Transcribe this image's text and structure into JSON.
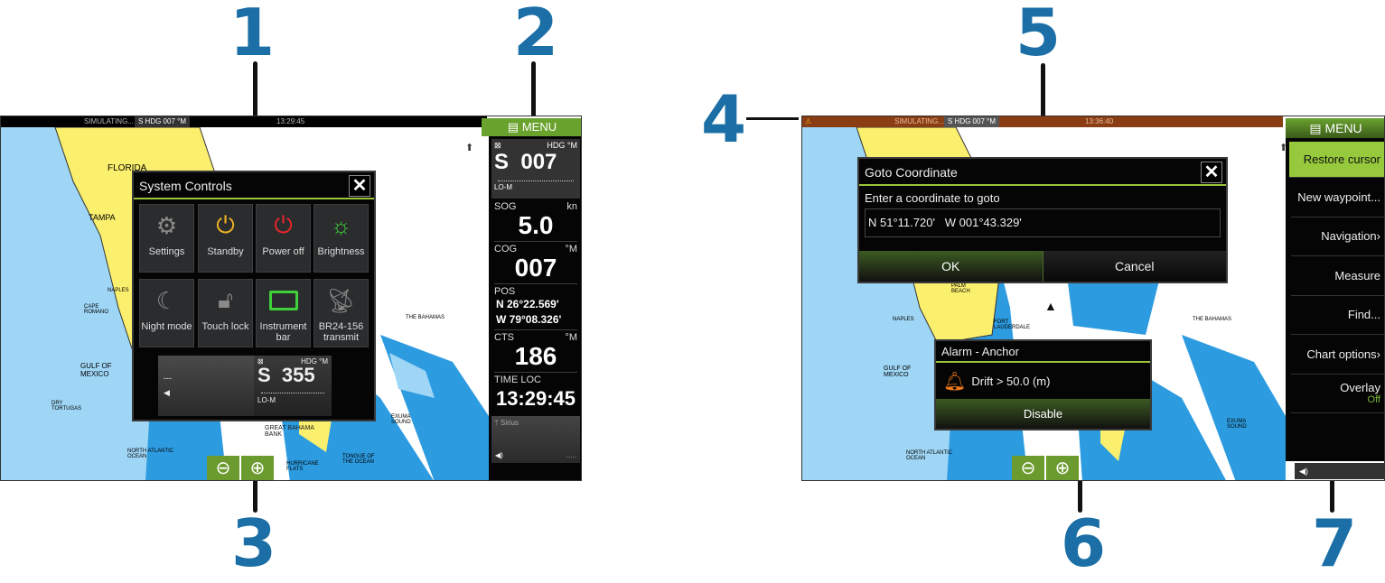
{
  "callouts": [
    "1",
    "2",
    "3",
    "4",
    "5",
    "6",
    "7"
  ],
  "left": {
    "topbar": {
      "status": "SIMULATING...",
      "heading": "S HDG 007 °M",
      "time": "13:29:45"
    },
    "menu_label": "MENU",
    "system_controls": {
      "title": "System Controls",
      "close": "✕",
      "tiles": [
        {
          "label": "Settings",
          "icon": "gear-icon",
          "color": "#8a8a8a"
        },
        {
          "label": "Standby",
          "icon": "power-icon",
          "color": "#f0b323"
        },
        {
          "label": "Power off",
          "icon": "power-icon",
          "color": "#e8262b"
        },
        {
          "label": "Brightness",
          "icon": "sun-icon",
          "color": "#3fd13a"
        },
        {
          "label": "Night mode",
          "icon": "moon-icon",
          "color": "#8a8a8a"
        },
        {
          "label": "Touch lock",
          "icon": "unlock-icon",
          "color": "#8a8a8a"
        },
        {
          "label": "Instrument bar",
          "icon": "display-icon",
          "color": "#3fd13a"
        },
        {
          "label": "BR24-156 transmit",
          "icon": "radar-icon",
          "color": "#8a8a8a"
        }
      ],
      "bar_left": {
        "value": "---"
      },
      "bar_right": {
        "hdg": "HDG °M",
        "dir": "S",
        "value": "355",
        "mode": "LO-M"
      }
    },
    "instruments": {
      "hdg": {
        "label": "HDG °M",
        "dir": "S",
        "value": "007",
        "mode": "LO-M"
      },
      "sog": {
        "label": "SOG",
        "unit": "kn",
        "value": "5.0"
      },
      "cog": {
        "label": "COG",
        "unit": "°M",
        "value": "007"
      },
      "pos": {
        "label": "POS",
        "lat": "N  26°22.569'",
        "lon": "W  79°08.326'"
      },
      "cts": {
        "label": "CTS",
        "unit": "°M",
        "value": "186"
      },
      "time": {
        "label": "TIME LOC",
        "value": "13:29:45"
      },
      "audio": {
        "source": "Sirius",
        "dots": "....."
      }
    },
    "map_labels": [
      "FLORIDA",
      "TAMPA",
      "GULF OF MEXICO",
      "THE BAHAMAS",
      "NORTH ATLANTIC OCEAN",
      "HURRICANE FLATS",
      "TONGUE OF THE OCEAN",
      "EXUMA SOUND",
      "GREAT BAHAMA BANK",
      "DRY TORTUGAS",
      "NAPLES",
      "CAPE ROMANO"
    ]
  },
  "right": {
    "topbar": {
      "status": "SIMULATING...",
      "heading": "S HDG 007 °M",
      "time": "13:36:40"
    },
    "menu": {
      "title": "MENU",
      "items": [
        {
          "label": "Restore cursor",
          "active": true
        },
        {
          "label": "New waypoint..."
        },
        {
          "label": "Navigation›"
        },
        {
          "label": "Measure"
        },
        {
          "label": "Find..."
        },
        {
          "label": "Chart options›"
        },
        {
          "label": "Overlay",
          "sub": "Off"
        }
      ]
    },
    "goto": {
      "title": "Goto Coordinate",
      "close": "✕",
      "prompt": "Enter a coordinate to goto",
      "value": "N 51°11.720'   W 001°43.329'",
      "ok": "OK",
      "cancel": "Cancel"
    },
    "alarm": {
      "title": "Alarm - Anchor",
      "message": "Drift > 50.0 (m)",
      "disable": "Disable",
      "icon_color": "#f07a1a"
    },
    "map_labels": [
      "THE BAHAMAS",
      "NAPLES",
      "GULF OF MEXICO",
      "NORTH ATLANTIC OCEAN",
      "EXUMA SOUND",
      "PALM BEACH",
      "FORT LAUDERDALE"
    ]
  },
  "colors": {
    "accent_green": "#9ac43a",
    "callout_blue": "#1b6fa6",
    "land": "#fbef6e",
    "deep": "#2d9be0",
    "shallow": "#9fd6f5",
    "alert_bar": "#8a3c12"
  }
}
